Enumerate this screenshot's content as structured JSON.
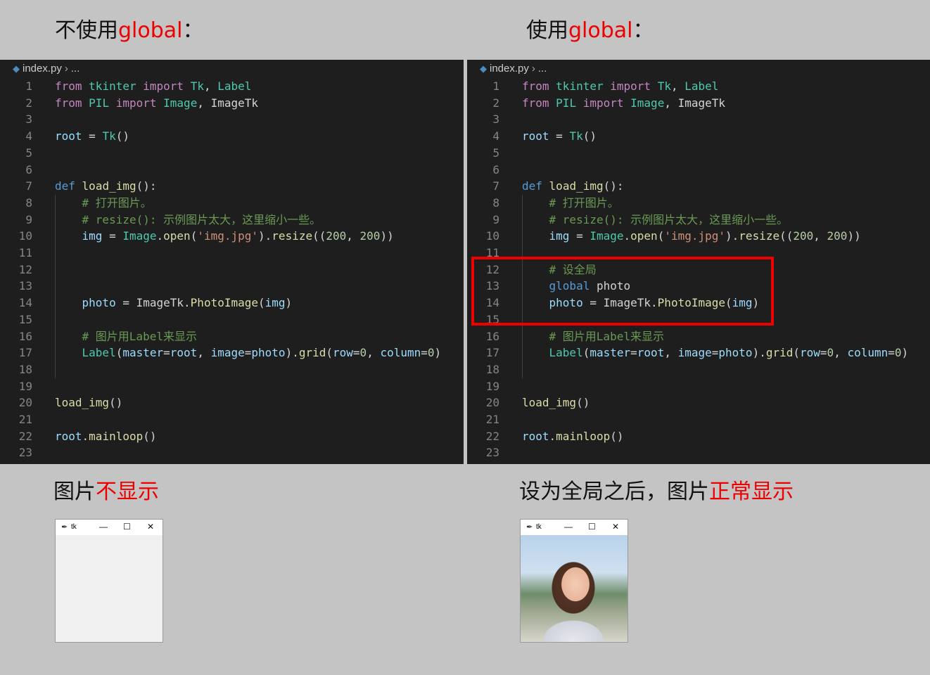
{
  "headings": {
    "left": {
      "prefix": "不使用",
      "highlight": "global",
      "suffix": "："
    },
    "right": {
      "prefix": "使用",
      "highlight": "global",
      "suffix": "："
    },
    "bottom_left": {
      "prefix": "图片",
      "highlight": "不显示"
    },
    "bottom_right": {
      "prefix": "设为全局之后，图片",
      "highlight": "正常显示"
    }
  },
  "editor": {
    "filename": "index.py",
    "breadcrumb_sep": "›",
    "breadcrumb_more": "...",
    "left_lines": [
      {
        "n": "1",
        "t": [
          [
            "kwc",
            "from"
          ],
          [
            "pl",
            " "
          ],
          [
            "cls",
            "tkinter"
          ],
          [
            "pl",
            " "
          ],
          [
            "kwc",
            "import"
          ],
          [
            "pl",
            " "
          ],
          [
            "cls",
            "Tk"
          ],
          [
            "pl",
            ", "
          ],
          [
            "cls",
            "Label"
          ]
        ]
      },
      {
        "n": "2",
        "t": [
          [
            "kwc",
            "from"
          ],
          [
            "pl",
            " "
          ],
          [
            "cls",
            "PIL"
          ],
          [
            "pl",
            " "
          ],
          [
            "kwc",
            "import"
          ],
          [
            "pl",
            " "
          ],
          [
            "cls",
            "Image"
          ],
          [
            "pl",
            ", ImageTk"
          ]
        ]
      },
      {
        "n": "3",
        "t": []
      },
      {
        "n": "4",
        "t": [
          [
            "var",
            "root"
          ],
          [
            "pl",
            " = "
          ],
          [
            "cls",
            "Tk"
          ],
          [
            "pl",
            "()"
          ]
        ]
      },
      {
        "n": "5",
        "t": []
      },
      {
        "n": "6",
        "t": []
      },
      {
        "n": "7",
        "t": [
          [
            "kw",
            "def"
          ],
          [
            "pl",
            " "
          ],
          [
            "fn",
            "load_img"
          ],
          [
            "pl",
            "():"
          ]
        ]
      },
      {
        "n": "8",
        "t": [
          [
            "pl",
            "    "
          ],
          [
            "cmt",
            "# 打开图片。"
          ]
        ]
      },
      {
        "n": "9",
        "t": [
          [
            "pl",
            "    "
          ],
          [
            "cmt",
            "# resize(): 示例图片太大，这里缩小一些。"
          ]
        ]
      },
      {
        "n": "10",
        "t": [
          [
            "pl",
            "    "
          ],
          [
            "var",
            "img"
          ],
          [
            "pl",
            " = "
          ],
          [
            "cls",
            "Image"
          ],
          [
            "pl",
            "."
          ],
          [
            "fn",
            "open"
          ],
          [
            "pl",
            "("
          ],
          [
            "str",
            "'img.jpg'"
          ],
          [
            "pl",
            ")."
          ],
          [
            "fn",
            "resize"
          ],
          [
            "pl",
            "(("
          ],
          [
            "num",
            "200"
          ],
          [
            "pl",
            ", "
          ],
          [
            "num",
            "200"
          ],
          [
            "pl",
            "))"
          ]
        ]
      },
      {
        "n": "11",
        "t": []
      },
      {
        "n": "12",
        "t": []
      },
      {
        "n": "13",
        "t": []
      },
      {
        "n": "14",
        "t": [
          [
            "pl",
            "    "
          ],
          [
            "var",
            "photo"
          ],
          [
            "pl",
            " = ImageTk."
          ],
          [
            "fn",
            "PhotoImage"
          ],
          [
            "pl",
            "("
          ],
          [
            "var",
            "img"
          ],
          [
            "pl",
            ")"
          ]
        ]
      },
      {
        "n": "15",
        "t": []
      },
      {
        "n": "16",
        "t": [
          [
            "pl",
            "    "
          ],
          [
            "cmt",
            "# 图片用Label来显示"
          ]
        ]
      },
      {
        "n": "17",
        "t": [
          [
            "pl",
            "    "
          ],
          [
            "cls",
            "Label"
          ],
          [
            "pl",
            "("
          ],
          [
            "var",
            "master"
          ],
          [
            "pl",
            "="
          ],
          [
            "var",
            "root"
          ],
          [
            "pl",
            ", "
          ],
          [
            "var",
            "image"
          ],
          [
            "pl",
            "="
          ],
          [
            "var",
            "photo"
          ],
          [
            "pl",
            ")."
          ],
          [
            "fn",
            "grid"
          ],
          [
            "pl",
            "("
          ],
          [
            "var",
            "row"
          ],
          [
            "pl",
            "="
          ],
          [
            "num",
            "0"
          ],
          [
            "pl",
            ", "
          ],
          [
            "var",
            "column"
          ],
          [
            "pl",
            "="
          ],
          [
            "num",
            "0"
          ],
          [
            "pl",
            ")"
          ]
        ]
      },
      {
        "n": "18",
        "t": []
      },
      {
        "n": "19",
        "t": []
      },
      {
        "n": "20",
        "t": [
          [
            "fn",
            "load_img"
          ],
          [
            "pl",
            "()"
          ]
        ]
      },
      {
        "n": "21",
        "t": []
      },
      {
        "n": "22",
        "t": [
          [
            "var",
            "root"
          ],
          [
            "pl",
            "."
          ],
          [
            "fn",
            "mainloop"
          ],
          [
            "pl",
            "()"
          ]
        ]
      },
      {
        "n": "23",
        "t": []
      }
    ],
    "right_lines": [
      {
        "n": "1",
        "t": [
          [
            "kwc",
            "from"
          ],
          [
            "pl",
            " "
          ],
          [
            "cls",
            "tkinter"
          ],
          [
            "pl",
            " "
          ],
          [
            "kwc",
            "import"
          ],
          [
            "pl",
            " "
          ],
          [
            "cls",
            "Tk"
          ],
          [
            "pl",
            ", "
          ],
          [
            "cls",
            "Label"
          ]
        ]
      },
      {
        "n": "2",
        "t": [
          [
            "kwc",
            "from"
          ],
          [
            "pl",
            " "
          ],
          [
            "cls",
            "PIL"
          ],
          [
            "pl",
            " "
          ],
          [
            "kwc",
            "import"
          ],
          [
            "pl",
            " "
          ],
          [
            "cls",
            "Image"
          ],
          [
            "pl",
            ", ImageTk"
          ]
        ]
      },
      {
        "n": "3",
        "t": []
      },
      {
        "n": "4",
        "t": [
          [
            "var",
            "root"
          ],
          [
            "pl",
            " = "
          ],
          [
            "cls",
            "Tk"
          ],
          [
            "pl",
            "()"
          ]
        ]
      },
      {
        "n": "5",
        "t": []
      },
      {
        "n": "6",
        "t": []
      },
      {
        "n": "7",
        "t": [
          [
            "kw",
            "def"
          ],
          [
            "pl",
            " "
          ],
          [
            "fn",
            "load_img"
          ],
          [
            "pl",
            "():"
          ]
        ]
      },
      {
        "n": "8",
        "t": [
          [
            "pl",
            "    "
          ],
          [
            "cmt",
            "# 打开图片。"
          ]
        ]
      },
      {
        "n": "9",
        "t": [
          [
            "pl",
            "    "
          ],
          [
            "cmt",
            "# resize(): 示例图片太大，这里缩小一些。"
          ]
        ]
      },
      {
        "n": "10",
        "t": [
          [
            "pl",
            "    "
          ],
          [
            "var",
            "img"
          ],
          [
            "pl",
            " = "
          ],
          [
            "cls",
            "Image"
          ],
          [
            "pl",
            "."
          ],
          [
            "fn",
            "open"
          ],
          [
            "pl",
            "("
          ],
          [
            "str",
            "'img.jpg'"
          ],
          [
            "pl",
            ")."
          ],
          [
            "fn",
            "resize"
          ],
          [
            "pl",
            "(("
          ],
          [
            "num",
            "200"
          ],
          [
            "pl",
            ", "
          ],
          [
            "num",
            "200"
          ],
          [
            "pl",
            "))"
          ]
        ]
      },
      {
        "n": "11",
        "t": []
      },
      {
        "n": "12",
        "t": [
          [
            "pl",
            "    "
          ],
          [
            "cmt",
            "# 设全局"
          ]
        ]
      },
      {
        "n": "13",
        "t": [
          [
            "pl",
            "    "
          ],
          [
            "kw",
            "global"
          ],
          [
            "pl",
            " photo"
          ]
        ]
      },
      {
        "n": "14",
        "t": [
          [
            "pl",
            "    "
          ],
          [
            "var",
            "photo"
          ],
          [
            "pl",
            " = ImageTk."
          ],
          [
            "fn",
            "PhotoImage"
          ],
          [
            "pl",
            "("
          ],
          [
            "var",
            "img"
          ],
          [
            "pl",
            ")"
          ]
        ]
      },
      {
        "n": "15",
        "t": []
      },
      {
        "n": "16",
        "t": [
          [
            "pl",
            "    "
          ],
          [
            "cmt",
            "# 图片用Label来显示"
          ]
        ]
      },
      {
        "n": "17",
        "t": [
          [
            "pl",
            "    "
          ],
          [
            "cls",
            "Label"
          ],
          [
            "pl",
            "("
          ],
          [
            "var",
            "master"
          ],
          [
            "pl",
            "="
          ],
          [
            "var",
            "root"
          ],
          [
            "pl",
            ", "
          ],
          [
            "var",
            "image"
          ],
          [
            "pl",
            "="
          ],
          [
            "var",
            "photo"
          ],
          [
            "pl",
            ")."
          ],
          [
            "fn",
            "grid"
          ],
          [
            "pl",
            "("
          ],
          [
            "var",
            "row"
          ],
          [
            "pl",
            "="
          ],
          [
            "num",
            "0"
          ],
          [
            "pl",
            ", "
          ],
          [
            "var",
            "column"
          ],
          [
            "pl",
            "="
          ],
          [
            "num",
            "0"
          ],
          [
            "pl",
            ")"
          ]
        ]
      },
      {
        "n": "18",
        "t": []
      },
      {
        "n": "19",
        "t": []
      },
      {
        "n": "20",
        "t": [
          [
            "fn",
            "load_img"
          ],
          [
            "pl",
            "()"
          ]
        ]
      },
      {
        "n": "21",
        "t": []
      },
      {
        "n": "22",
        "t": [
          [
            "var",
            "root"
          ],
          [
            "pl",
            "."
          ],
          [
            "fn",
            "mainloop"
          ],
          [
            "pl",
            "()"
          ]
        ]
      },
      {
        "n": "23",
        "t": []
      }
    ]
  },
  "tk_window": {
    "title": "tk",
    "minimize": "—",
    "maximize": "☐",
    "close": "✕"
  },
  "colors": {
    "highlight": "#ee0000",
    "editor_bg": "#1e1e1e",
    "page_bg": "#c4c4c4"
  }
}
